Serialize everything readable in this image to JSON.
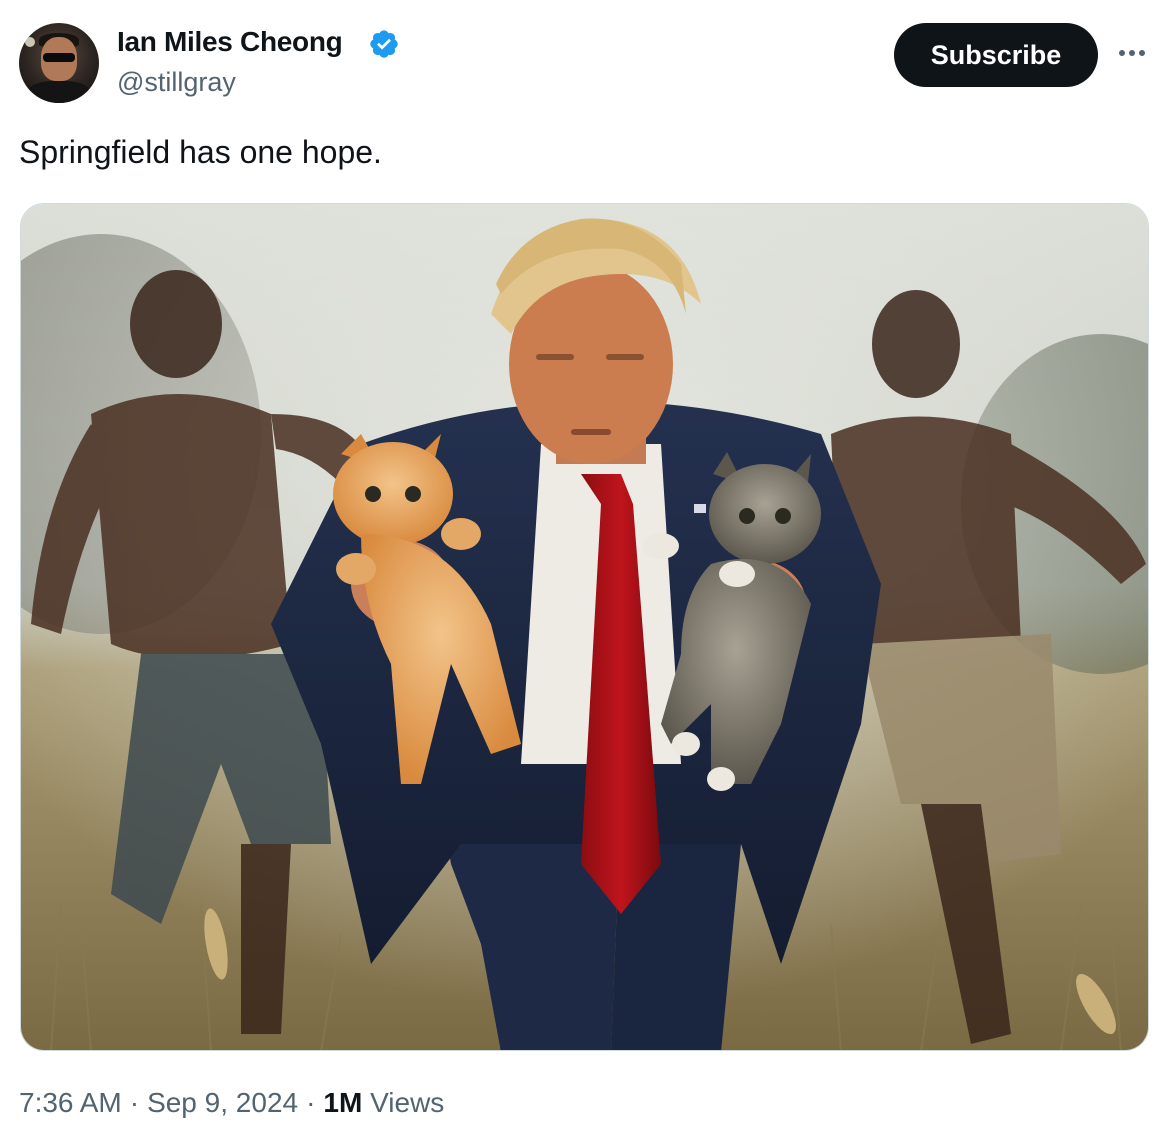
{
  "author": {
    "display_name": "Ian Miles Cheong",
    "handle": "@stillgray",
    "verified": true,
    "verified_color": "#1d9bf0"
  },
  "actions": {
    "subscribe_label": "Subscribe",
    "more_icon": "more-horizontal-icon"
  },
  "tweet": {
    "text": "Springfield has one hope."
  },
  "meta": {
    "time": "7:36 AM",
    "date": "Sep 9, 2024",
    "views_count": "1M",
    "views_label": "Views"
  },
  "colors": {
    "text_primary": "#0f1419",
    "text_secondary": "#536471",
    "button_bg": "#0f1419",
    "border": "#cfd9de"
  }
}
